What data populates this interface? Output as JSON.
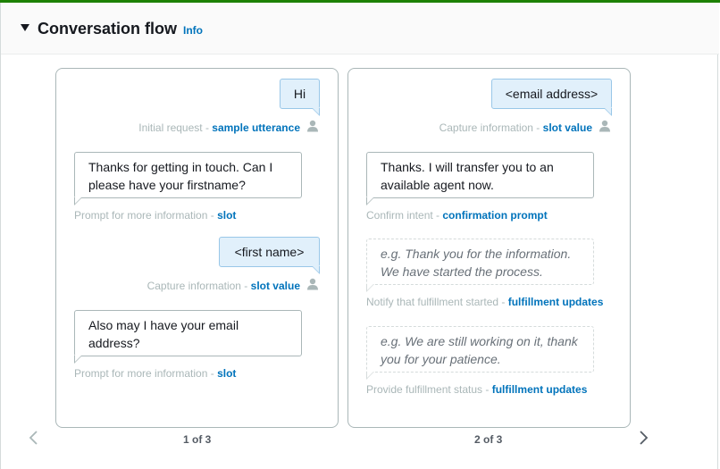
{
  "section": {
    "title": "Conversation flow",
    "info_label": "Info"
  },
  "card1": {
    "initial_request": {
      "bubble": "Hi",
      "caption_prefix": "Initial request",
      "separator": " - ",
      "caption_link": "sample utterance"
    },
    "prompt_firstname": {
      "bubble": "Thanks for getting in touch. Can I please have your firstname?",
      "caption_prefix": "Prompt for more information",
      "separator": " - ",
      "caption_link": "slot"
    },
    "capture_firstname": {
      "bubble": "<first name>",
      "caption_prefix": "Capture information",
      "separator": " - ",
      "caption_link": "slot value"
    },
    "prompt_email": {
      "bubble": "Also may I have your email address?",
      "caption_prefix": "Prompt for more information",
      "separator": " - ",
      "caption_link": "slot"
    },
    "pager": "1 of 3"
  },
  "card2": {
    "capture_email": {
      "bubble": "<email address>",
      "caption_prefix": "Capture information",
      "separator": " - ",
      "caption_link": "slot value"
    },
    "confirm_intent": {
      "bubble": "Thanks. I will transfer you to an available agent now.",
      "caption_prefix": "Confirm intent",
      "separator": " - ",
      "caption_link": "confirmation prompt"
    },
    "fulfillment_started": {
      "placeholder": "e.g. Thank you for the information. We have started the process.",
      "caption_prefix": "Notify that fulfillment started",
      "separator": " - ",
      "caption_link": "fulfillment updates"
    },
    "fulfillment_status": {
      "placeholder": "e.g. We are still working on it, thank you for your patience.",
      "caption_prefix": "Provide fulfillment status",
      "separator": " - ",
      "caption_link": "fulfillment updates"
    },
    "pager": "2 of 3"
  },
  "icons": {
    "collapse": "caret-down-icon",
    "user": "user-icon",
    "prev": "chevron-left-icon",
    "next": "chevron-right-icon"
  },
  "colors": {
    "accent": "#1d8102",
    "link": "#0073bb",
    "user_bubble": "#e1f0fb"
  }
}
